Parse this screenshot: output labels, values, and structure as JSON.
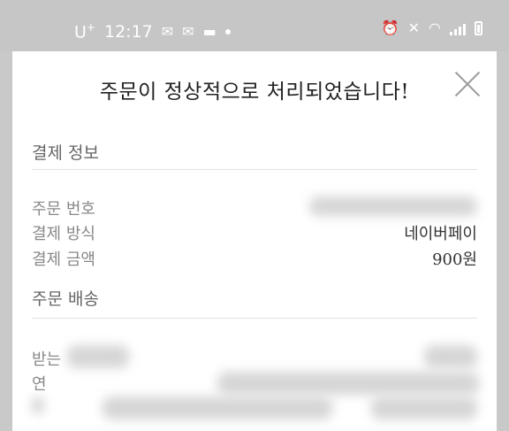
{
  "status_bar": {
    "carrier": "U",
    "carrier_mark": "+",
    "time": "12:17"
  },
  "dialog": {
    "title": "주문이 정상적으로 처리되었습니다!",
    "payment_section": {
      "heading": "결제 정보",
      "rows": [
        {
          "label": "주문 번호",
          "value": ""
        },
        {
          "label": "결제 방식",
          "value": "네이버페이"
        },
        {
          "label": "결제 금액",
          "value": "900원"
        }
      ]
    },
    "delivery_section": {
      "heading": "주문 배송",
      "rows": [
        {
          "label": "받는",
          "value": ""
        },
        {
          "label": "연",
          "value": ""
        },
        {
          "label": "",
          "value": ""
        }
      ]
    }
  }
}
